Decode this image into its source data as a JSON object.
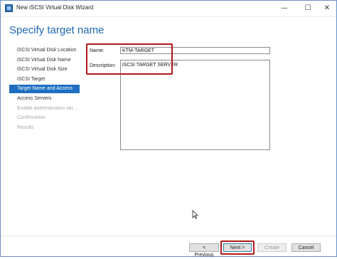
{
  "window": {
    "title": "New iSCSI Virtual Disk Wizard",
    "controls": {
      "minimize": "—",
      "maximize": "☐",
      "close": "✕"
    }
  },
  "header": {
    "title": "Specify target name"
  },
  "nav": {
    "items": [
      {
        "label": "iSCSI Virtual Disk Location",
        "state": "normal"
      },
      {
        "label": "iSCSI Virtual Disk Name",
        "state": "normal"
      },
      {
        "label": "iSCSI Virtual Disk Size",
        "state": "normal"
      },
      {
        "label": "iSCSI Target",
        "state": "normal"
      },
      {
        "label": "Target Name and Access",
        "state": "active"
      },
      {
        "label": "Access Servers",
        "state": "normal"
      },
      {
        "label": "Enable authentication ser...",
        "state": "disabled"
      },
      {
        "label": "Confirmation",
        "state": "disabled"
      },
      {
        "label": "Results",
        "state": "disabled"
      }
    ]
  },
  "form": {
    "name_label": "Name:",
    "name_value": "KTM-TARGET",
    "description_label": "Description:",
    "description_value": "iSCSI TARGET SERVER"
  },
  "buttons": {
    "previous": "< Previous",
    "next": "Next >",
    "create": "Create",
    "cancel": "Cancel"
  },
  "colors": {
    "accent": "#1e6fbf",
    "title_blue": "#1f68b1",
    "highlight_red": "#b01919"
  }
}
